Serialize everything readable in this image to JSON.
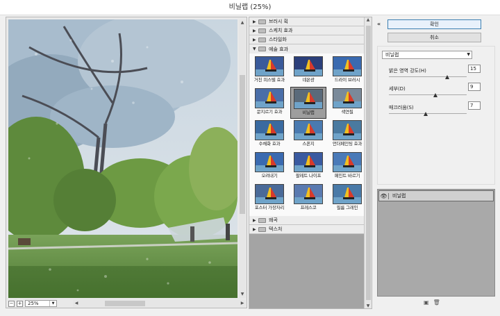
{
  "window": {
    "title": "비닐랩 (25%)"
  },
  "preview": {
    "zoom": "25%",
    "zoom_minus": "−",
    "zoom_plus": "+"
  },
  "filter_tree": {
    "folders_top": [
      {
        "label": "브러시 획"
      },
      {
        "label": "스케치 효과"
      },
      {
        "label": "스타일화"
      }
    ],
    "open_folder": {
      "label": "예술 효과"
    },
    "filters": [
      {
        "label": "거친 피스텔 효과",
        "selected": false
      },
      {
        "label": "네온광",
        "selected": false
      },
      {
        "label": "드라이 브러시",
        "selected": false
      },
      {
        "label": "문지르기 효과",
        "selected": false
      },
      {
        "label": "비닐랩",
        "selected": true
      },
      {
        "label": "색연필",
        "selected": false
      },
      {
        "label": "수채화 효과",
        "selected": false
      },
      {
        "label": "스폰지",
        "selected": false
      },
      {
        "label": "언더페인팅 효과",
        "selected": false
      },
      {
        "label": "오려내기",
        "selected": false
      },
      {
        "label": "팔레트 나이프",
        "selected": false
      },
      {
        "label": "페인트 바르기",
        "selected": false
      },
      {
        "label": "포스터 가장자리",
        "selected": false
      },
      {
        "label": "프레스코",
        "selected": false
      },
      {
        "label": "필름 그레인",
        "selected": false
      }
    ],
    "folders_bottom": [
      {
        "label": "왜곡"
      },
      {
        "label": "텍스처"
      }
    ]
  },
  "actions": {
    "ok_label": "확인",
    "cancel_label": "취소"
  },
  "settings": {
    "selected_filter": "비닐랩",
    "params": [
      {
        "label": "밝은 영역 강도(H)",
        "value": "15",
        "fraction": 0.75
      },
      {
        "label": "세부(D)",
        "value": "9",
        "fraction": 0.6
      },
      {
        "label": "매끄러움(S)",
        "value": "7",
        "fraction": 0.47
      }
    ]
  },
  "layers": {
    "items": [
      {
        "label": "비닐랩",
        "visible_icon": "eye-icon"
      }
    ],
    "new_layer_icon": "new-layer-icon",
    "delete_icon": "trash-icon"
  }
}
